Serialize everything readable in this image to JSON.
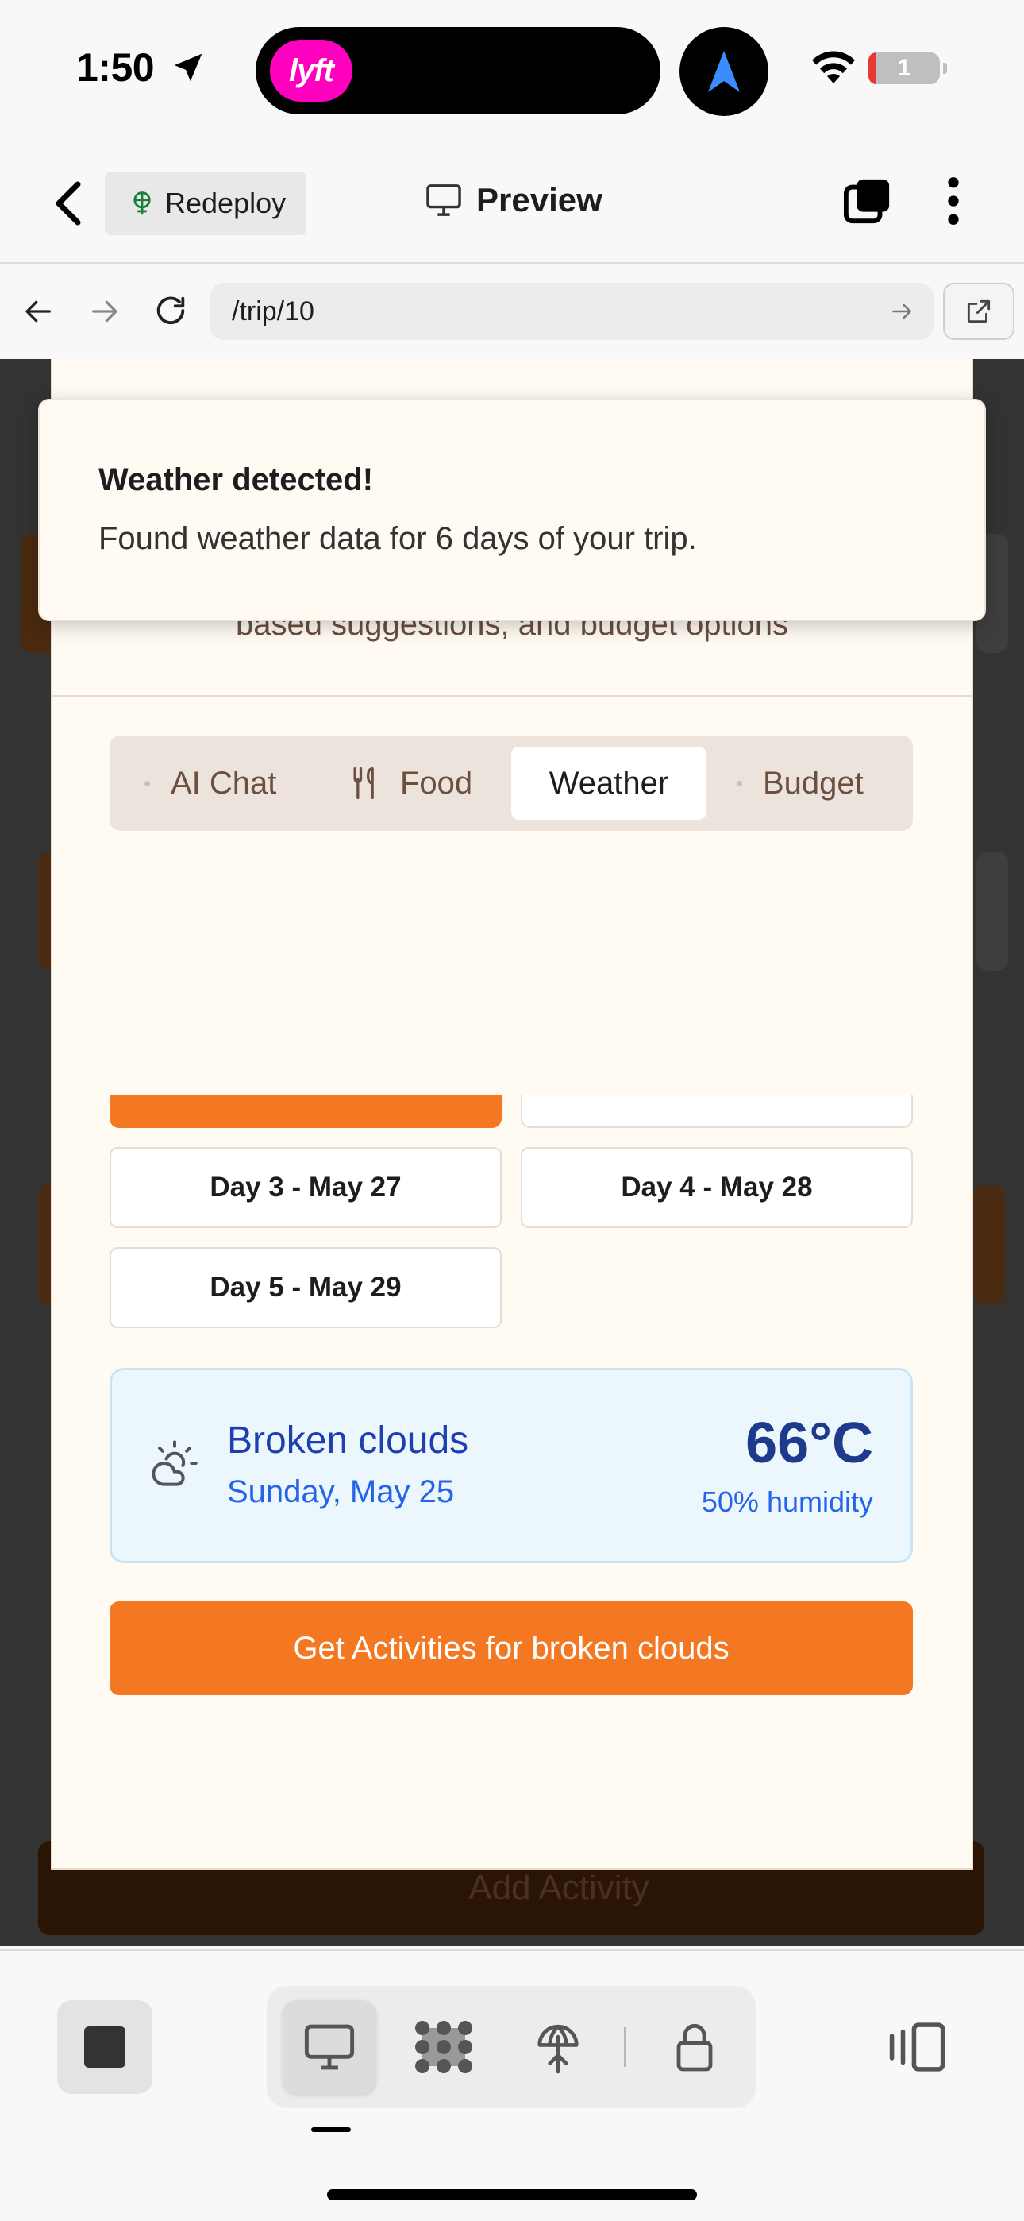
{
  "status_bar": {
    "time": "1:50",
    "lyft_label": "lyft",
    "battery_text": "1"
  },
  "app_header": {
    "redeploy_label": "Redeploy",
    "preview_label": "Preview"
  },
  "url_bar": {
    "url": "/trip/10"
  },
  "modal": {
    "subtitle": "based suggestions, and budget options",
    "tabs": [
      {
        "label": "AI Chat",
        "icon": "dot-icon",
        "active": false
      },
      {
        "label": "Food",
        "icon": "utensils-icon",
        "active": false
      },
      {
        "label": "Weather",
        "icon": "",
        "active": true
      },
      {
        "label": "Budget",
        "icon": "dot-icon",
        "active": false
      }
    ],
    "days": [
      {
        "label": "Day 3 - May 27"
      },
      {
        "label": "Day 4 - May 28"
      },
      {
        "label": "Day 5 - May 29"
      }
    ],
    "weather": {
      "condition": "Broken clouds",
      "date": "Sunday, May 25",
      "temperature": "66°C",
      "humidity": "50% humidity",
      "icon": "cloud-sun-icon"
    },
    "cta_label": "Get Activities for broken clouds"
  },
  "toast": {
    "title": "Weather detected!",
    "message": "Found weather data for 6 days of your trip."
  },
  "background": {
    "add_activity_label": "Add Activity"
  },
  "colors": {
    "accent": "#f47821",
    "weather_card_bg": "#ecf7fd",
    "weather_text": "#1e40af",
    "modal_bg": "#fffbf3"
  }
}
